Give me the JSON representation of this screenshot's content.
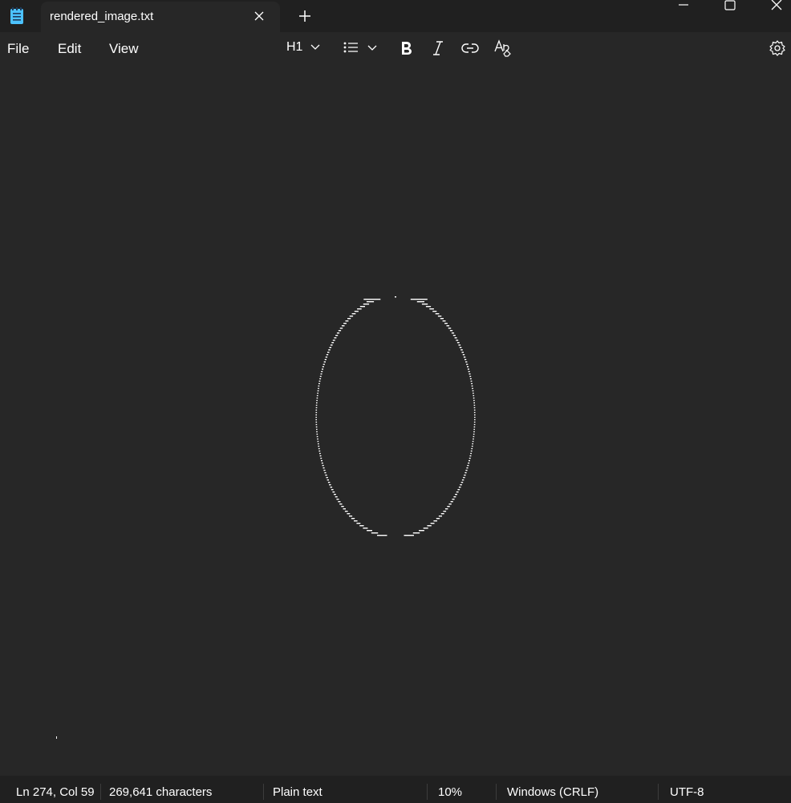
{
  "tab": {
    "title": "rendered_image.txt"
  },
  "menu": {
    "file": "File",
    "edit": "Edit",
    "view": "View"
  },
  "toolbar": {
    "heading_label": "H1"
  },
  "status": {
    "position": "Ln 274, Col 59",
    "characters": "269,641 characters",
    "format": "Plain text",
    "zoom": "10%",
    "line_ending": "Windows (CRLF)",
    "encoding": "UTF-8"
  },
  "colors": {
    "titlebar": "#202020",
    "editor_background": "#272727",
    "text": "#ffffff",
    "app_icon": "#4cc2ff"
  },
  "icons": {
    "app": "notepad-icon",
    "tab_close": "close-icon",
    "new_tab": "plus-icon",
    "minimize": "minimize-icon",
    "maximize": "maximize-icon",
    "window_close": "close-icon",
    "heading": "chevron-down-icon",
    "list": "bulleted-list-icon",
    "bold": "bold-icon",
    "italic": "italic-icon",
    "link": "link-icon",
    "clear_format": "clear-formatting-icon",
    "settings": "gear-icon"
  }
}
